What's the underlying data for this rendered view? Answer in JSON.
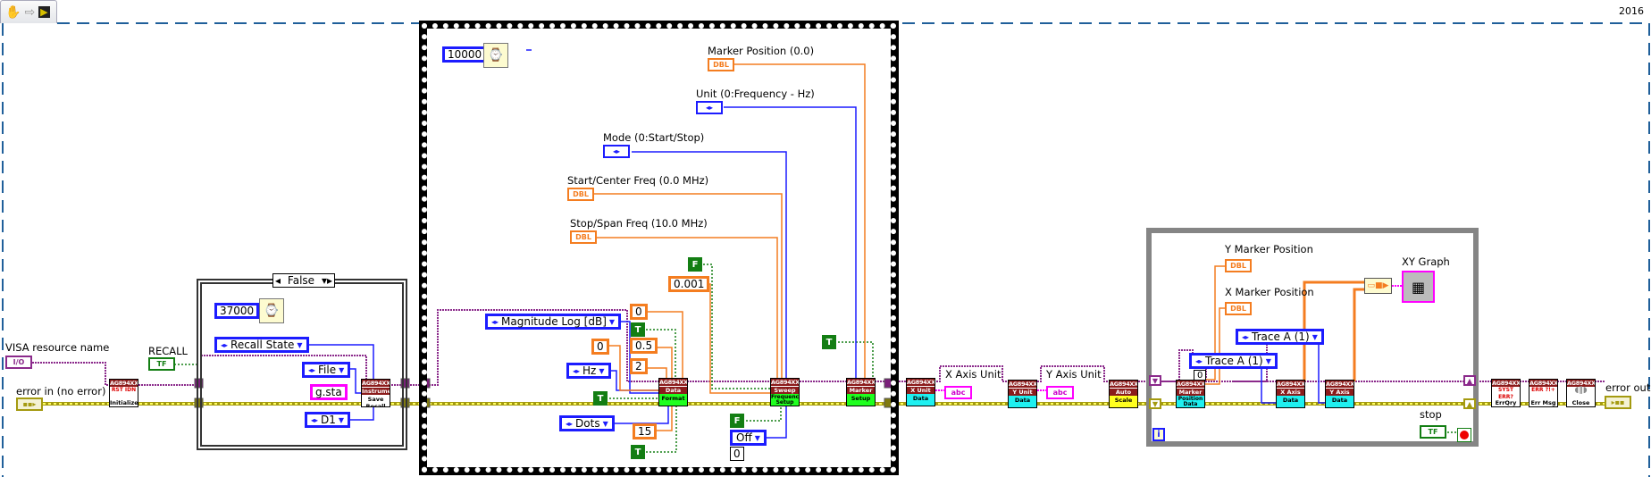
{
  "toolbar": {
    "icons": [
      "hand-icon",
      "arrow-icon",
      "run-vi-icon"
    ]
  },
  "version": "2016",
  "labels": {
    "visa": "VISA resource name",
    "error_in": "error in (no error)",
    "recall": "RECALL",
    "marker_pos": "Marker Position (0.0)",
    "unit": "Unit (0:Frequency - Hz)",
    "mode": "Mode (0:Start/Stop)",
    "start_freq": "Start/Center Freq (0.0 MHz)",
    "stop_freq": "Stop/Span Freq (10.0 MHz)",
    "x_axis_unit": "X Axis Unit",
    "y_axis_unit": "Y Axis Unit",
    "y_marker": "Y Marker Position",
    "x_marker": "X Marker Position",
    "xy_graph": "XY Graph",
    "stop": "stop",
    "error_out": "error out"
  },
  "terminals": {
    "io": "I/O",
    "dbl": "DBL",
    "tf": "TF",
    "abc": "abc",
    "enum": "◂▸"
  },
  "case": {
    "selector": "False"
  },
  "constants": {
    "wait1": "37000",
    "recall_state": "Recall State",
    "file": "File",
    "gsta": "g.sta",
    "d1": "D1",
    "wait2": "10000",
    "f1": "F",
    "c0001": "0.001",
    "mag": "Magnitude Log [dB]",
    "z1": "0",
    "t1": "T",
    "c05": "0.5",
    "c2": "2",
    "z2": "0",
    "hz": "Hz",
    "t2": "T",
    "dots": "Dots",
    "c15": "15",
    "t3": "T",
    "f2": "F",
    "off": "Off",
    "z3": "0",
    "t4": "T",
    "z4": "0",
    "traceA1": "Trace A (1)",
    "traceA2": "Trace A (1)",
    "loop_i": "i"
  },
  "nodes": [
    {
      "hd": "AG894XX",
      "mid": "",
      "bd": "Initialize"
    },
    {
      "hd": "AG894XX",
      "mid": "Instrument",
      "bd": "Save Recall"
    },
    {
      "hd": "AG894XX",
      "mid": "Data",
      "bd": "Format"
    },
    {
      "hd": "AG894XX",
      "mid": "Sweep",
      "bd": "Frequency Setup"
    },
    {
      "hd": "AG894XX",
      "mid": "Marker",
      "bd": "Setup"
    },
    {
      "hd": "AG894XX",
      "mid": "X Unit",
      "bd": "Data"
    },
    {
      "hd": "AG894XX",
      "mid": "Y Unit",
      "bd": "Data"
    },
    {
      "hd": "AG894XX",
      "mid": "Auto",
      "bd": "Scale"
    },
    {
      "hd": "AG894XX",
      "mid": "Marker",
      "bd": "Position Data"
    },
    {
      "hd": "AG894XX",
      "mid": "X Axis",
      "bd": "Data"
    },
    {
      "hd": "AG894XX",
      "mid": "Y Axis",
      "bd": "Data"
    },
    {
      "hd": "AG894XX",
      "mid": "",
      "bd": "ErrQry"
    },
    {
      "hd": "AG894XX",
      "mid": "",
      "bd": "Err Msg"
    },
    {
      "hd": "AG894XX",
      "mid": "",
      "bd": "Close"
    }
  ],
  "colors": {
    "visa_wire": "#8b2a8b",
    "error_wire": "#a49a10",
    "double_wire": "#f47d20",
    "enum_wire": "#1c1cff",
    "bool_wire": "#137e13",
    "string_wire": "#ff00ff",
    "loop": "#858585"
  }
}
